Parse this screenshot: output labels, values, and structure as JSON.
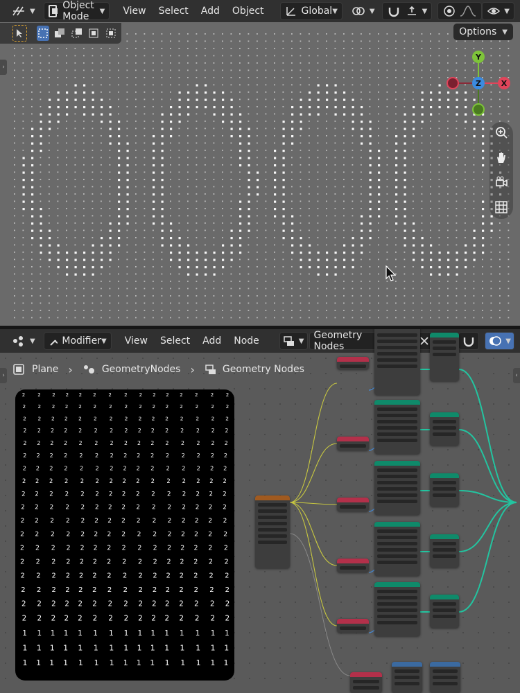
{
  "viewport": {
    "header": {
      "mode_label": "Object Mode",
      "menus": [
        "View",
        "Select",
        "Add",
        "Object"
      ],
      "transform_orientation": "Global"
    },
    "options_label": "Options",
    "gizmo": {
      "y": "Y",
      "x": "X",
      "z": "Z"
    }
  },
  "node_editor": {
    "header": {
      "editor_label": "Modifier",
      "menus": [
        "View",
        "Select",
        "Add",
        "Node"
      ],
      "tree_name": "Geometry Nodes"
    },
    "breadcrumb": [
      "Plane",
      "GeometryNodes",
      "Geometry Nodes"
    ]
  },
  "colors": {
    "header_bg": "#303030",
    "viewport_bg": "#6a6a6a",
    "node_bg": "#5a5a5a",
    "accent_blue": "#4772b3",
    "axis_x": "#e0445a",
    "axis_y": "#7ec43a",
    "axis_z": "#3b8be0",
    "string_node_header": "#b3304a",
    "geometry_node_header": "#0f8a6a",
    "noise_node_header": "#a05a20",
    "link_teal": "#23c4a0"
  }
}
